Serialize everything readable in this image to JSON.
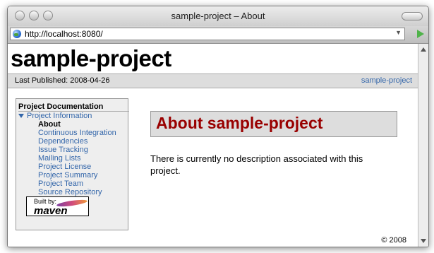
{
  "window": {
    "title": "sample-project – About"
  },
  "toolbar": {
    "url": "http://localhost:8080/"
  },
  "page": {
    "banner": "sample-project",
    "breadcrumbs": {
      "last_published": "Last Published:  2008-04-26",
      "project_link": "sample-project"
    },
    "nav": {
      "heading": "Project Documentation",
      "group": "Project Information",
      "items": [
        {
          "label": "About",
          "active": true
        },
        {
          "label": "Continuous Integration"
        },
        {
          "label": "Dependencies"
        },
        {
          "label": "Issue Tracking"
        },
        {
          "label": "Mailing Lists"
        },
        {
          "label": "Project License"
        },
        {
          "label": "Project Summary"
        },
        {
          "label": "Project Team"
        },
        {
          "label": "Source Repository"
        }
      ]
    },
    "powered_by": {
      "built_by": "Built by:",
      "logo_text": "maven"
    },
    "main": {
      "heading": "About sample-project",
      "description": "There is currently no description associated with this project."
    },
    "footer": {
      "copyright": "© 2008"
    }
  },
  "colors": {
    "link": "#3366aa",
    "heading": "#990000",
    "banner_bg": "#dddddd",
    "go_button": "#4fb34a"
  },
  "icons": [
    "globe-icon",
    "dropdown-arrow-icon",
    "go-arrow-icon",
    "disclosure-triangle-icon",
    "maven-feather-icon"
  ]
}
